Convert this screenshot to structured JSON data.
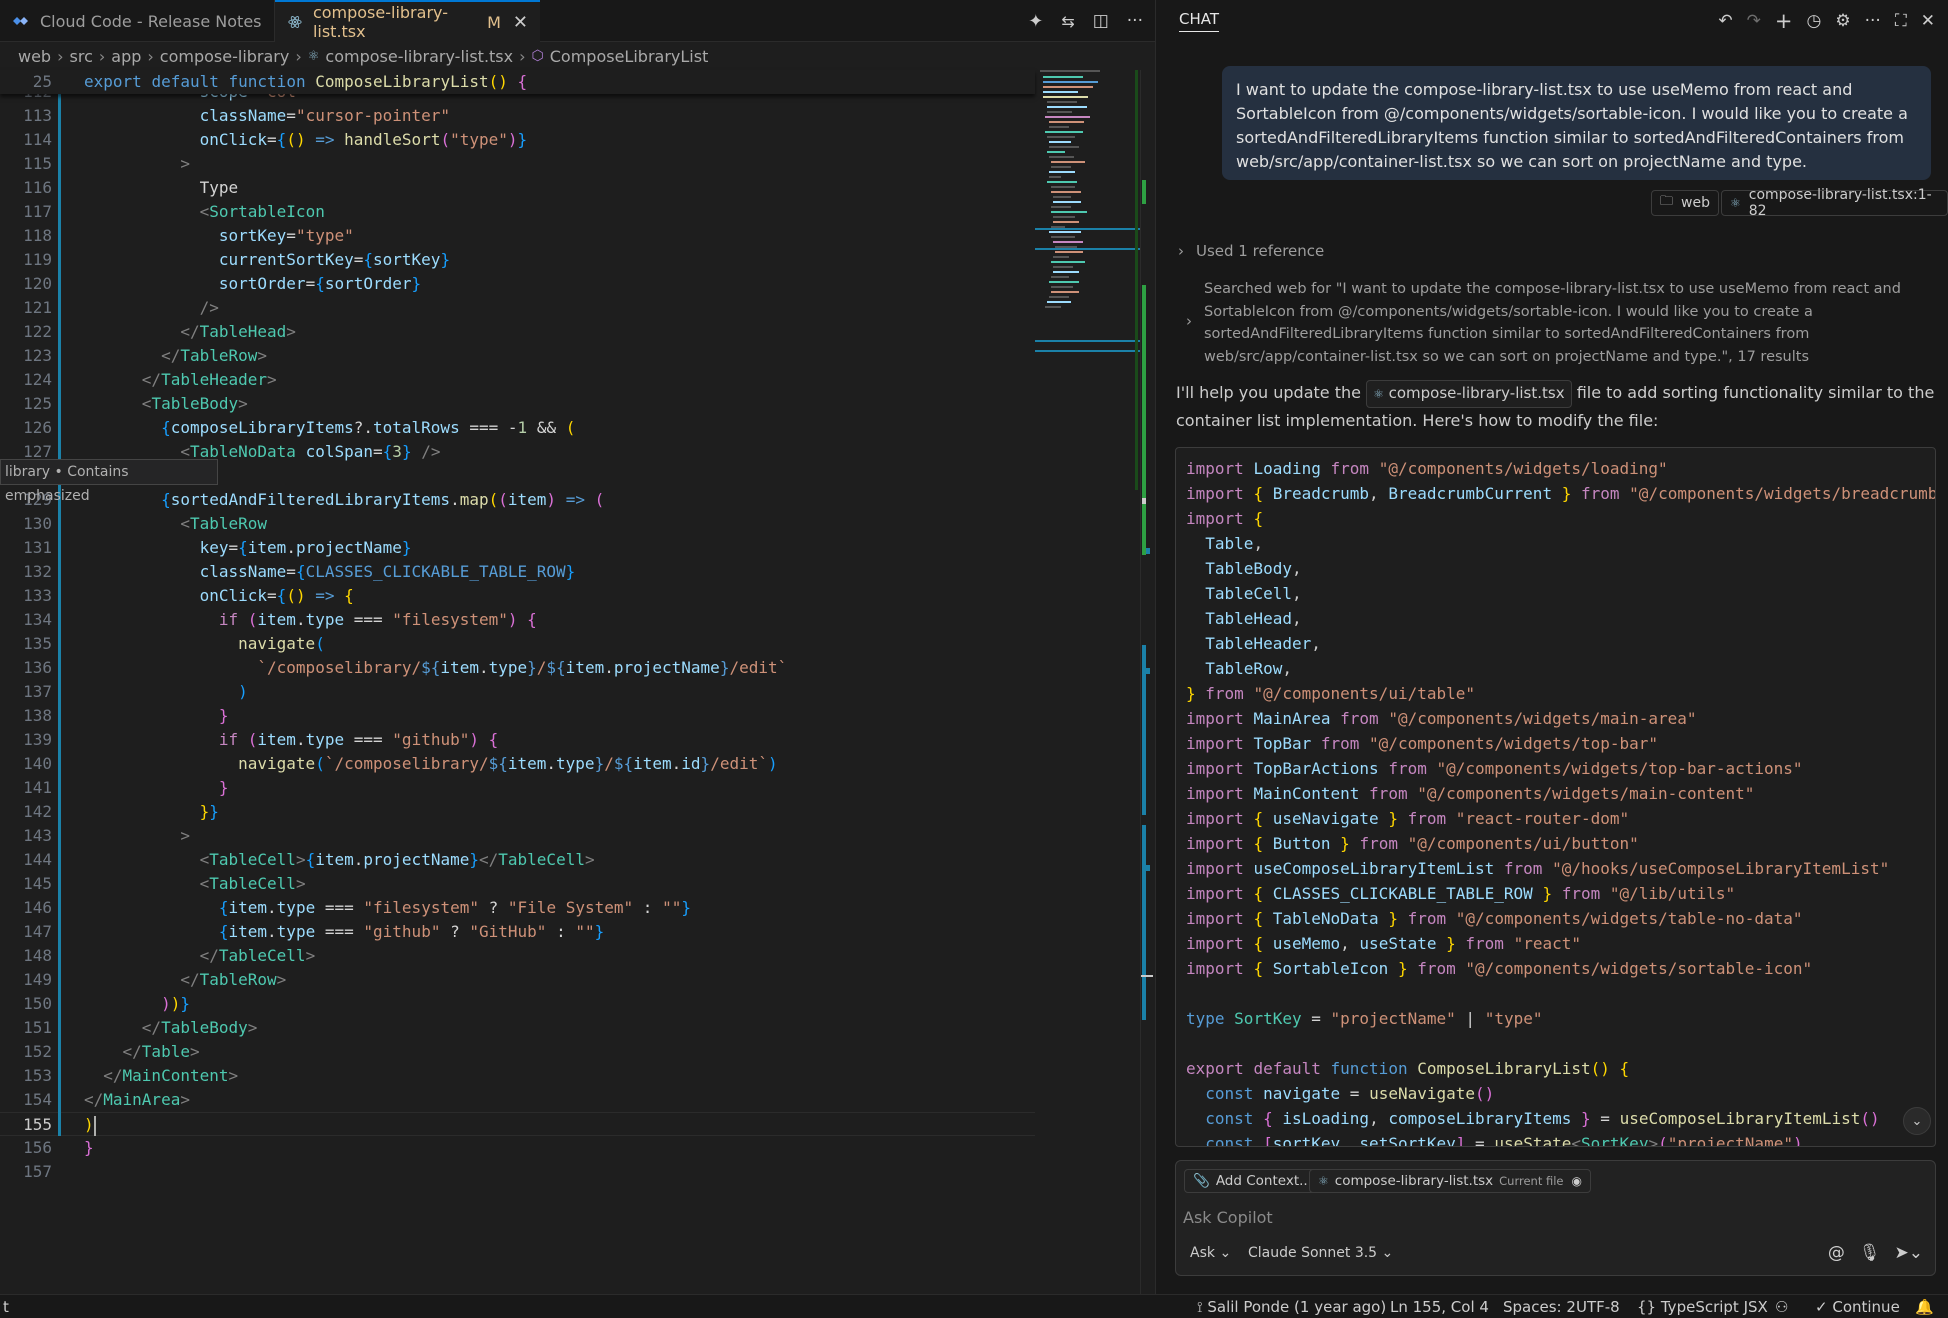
{
  "tabs": [
    {
      "label": "Cloud Code - Release Notes",
      "active": false
    },
    {
      "label": "compose-library-list.tsx",
      "badge": "M",
      "active": true
    }
  ],
  "breadcrumb": [
    "web",
    "src",
    "app",
    "compose-library",
    "compose-library-list.tsx",
    "ComposeLibraryList"
  ],
  "sticky_line": {
    "number": "25"
  },
  "hover_tooltip": "library • Contains emphasized",
  "editor_current_line": 155,
  "chat": {
    "title": "CHAT",
    "user_message": "I want to update the compose-library-list.tsx to use useMemo from react and SortableIcon from @/components/widgets/sortable-icon. I would like you to create a sortedAndFilteredLibraryItems function similar to sortedAndFilteredContainers from web/src/app/container-list.tsx so we can sort on projectName and type.",
    "context_chips": [
      "web",
      "compose-library-list.tsx:1-82"
    ],
    "used_reference": "Used 1 reference",
    "searched": "Searched web for \"I want to update the compose-library-list.tsx to use useMemo from react and SortableIcon from @/components/widgets/sortable-icon. I would like you to create a sortedAndFilteredLibraryItems function similar to sortedAndFilteredContainers from web/src/app/container-list.tsx so we can sort on projectName and type.\", 17 results",
    "response_before": "I'll help you update the",
    "response_chip": "compose-library-list.tsx",
    "response_after": "file to add sorting functionality similar to the container list implementation. Here's how to modify the file:",
    "input": {
      "add_context": "Add Context...",
      "file_chip": "compose-library-list.tsx",
      "file_chip_note": "Current file",
      "placeholder": "Ask Copilot",
      "mode": "Ask",
      "model": "Claude Sonnet 3.5"
    }
  },
  "status": {
    "left": "t",
    "blame": "Salil Ponde (1 year ago)",
    "position": "Ln 155, Col 4",
    "spaces": "Spaces: 2",
    "encoding": "UTF-8",
    "language": "TypeScript JSX",
    "continue": "Continue"
  }
}
